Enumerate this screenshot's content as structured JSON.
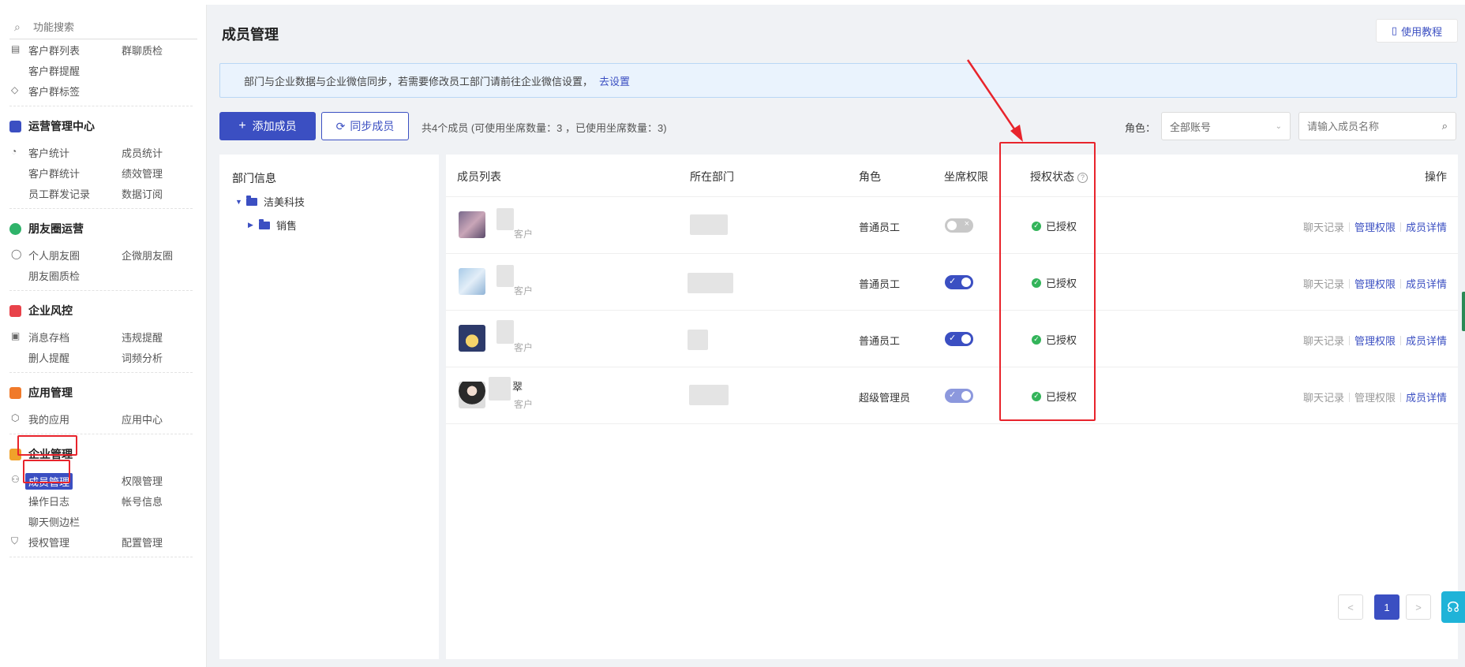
{
  "sidebar": {
    "search_placeholder": "功能搜索",
    "rows_top": [
      {
        "c1": "客户群列表",
        "c2": "群聊质检"
      },
      {
        "c1": "客户群提醒",
        "c2": ""
      },
      {
        "c1": "客户群标签",
        "c2": ""
      }
    ],
    "sections": [
      {
        "title": "运营管理中心",
        "rows": [
          [
            "客户统计",
            "成员统计"
          ],
          [
            "客户群统计",
            "绩效管理"
          ],
          [
            "员工群发记录",
            "数据订阅"
          ]
        ]
      },
      {
        "title": "朋友圈运营",
        "rows": [
          [
            "个人朋友圈",
            "企微朋友圈"
          ],
          [
            "朋友圈质检",
            ""
          ]
        ]
      },
      {
        "title": "企业风控",
        "rows": [
          [
            "消息存档",
            "违规提醒"
          ],
          [
            "删人提醒",
            "词频分析"
          ]
        ]
      },
      {
        "title": "应用管理",
        "rows": [
          [
            "我的应用",
            "应用中心"
          ]
        ]
      },
      {
        "title": "企业管理",
        "rows": [
          [
            "成员管理",
            "权限管理"
          ],
          [
            "操作日志",
            "帐号信息"
          ],
          [
            "聊天侧边栏",
            ""
          ],
          [
            "授权管理",
            "配置管理"
          ]
        ]
      }
    ]
  },
  "header": {
    "title": "成员管理",
    "tutorial": "使用教程"
  },
  "notice": {
    "text": "部门与企业数据与企业微信同步，若需要修改员工部门请前往企业微信设置，",
    "link": "去设置"
  },
  "toolbar": {
    "add": "添加成员",
    "sync": "同步成员",
    "count": "共4个成员   (可使用坐席数量：3 ，已使用坐席数量：3)",
    "role_label": "角色：",
    "role_value": "全部账号",
    "search_placeholder": "请输入成员名称"
  },
  "dept": {
    "title": "部门信息",
    "root": "洁美科技",
    "child": "销售"
  },
  "table": {
    "headers": [
      "成员列表",
      "所在部门",
      "角色",
      "坐席权限",
      "授权状态",
      "操作"
    ],
    "rows": [
      {
        "name_char": "",
        "sub": "客户",
        "role": "普通员工",
        "seat": true,
        "auth": "已授权",
        "ops": [
          "聊天记录",
          "管理权限",
          "成员详情"
        ]
      },
      {
        "name_char": "",
        "sub": "客户",
        "role": "普通员工",
        "seat": true,
        "auth": "已授权",
        "ops": [
          "聊天记录",
          "管理权限",
          "成员详情"
        ]
      },
      {
        "name_char": "",
        "sub": "客户",
        "role": "普通员工",
        "seat": true,
        "auth": "已授权",
        "ops": [
          "聊天记录",
          "管理权限",
          "成员详情"
        ]
      },
      {
        "name_char": "翠",
        "sub": "客户",
        "role": "超级管理员",
        "seat": true,
        "auth": "已授权",
        "ops": [
          "聊天记录",
          "管理权限",
          "成员详情"
        ]
      }
    ]
  },
  "pagination": {
    "current": "1",
    "prev": "<",
    "next": ">"
  },
  "colors": {
    "accent": "#3b4fc2",
    "annotation_red": "#e8242c",
    "success": "#33b45a"
  }
}
